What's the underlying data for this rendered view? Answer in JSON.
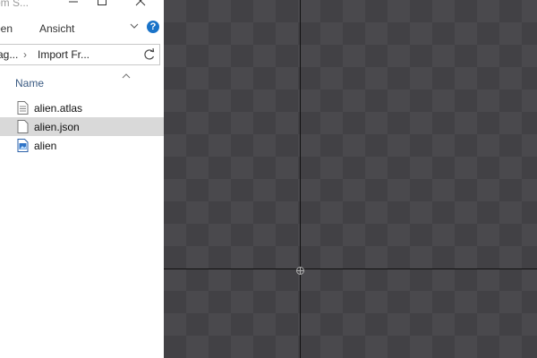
{
  "explorer": {
    "window_title": "om S...",
    "ribbon": {
      "tab_open": "ben",
      "tab_view": "Ansicht"
    },
    "address": {
      "crumb_parent": "ag...",
      "separator": "›",
      "crumb_current": "Import Fr..."
    },
    "column_name": "Name",
    "files": [
      {
        "name": "alien.atlas",
        "icon": "text-file-icon",
        "selected": false
      },
      {
        "name": "alien.json",
        "icon": "blank-file-icon",
        "selected": true
      },
      {
        "name": "alien",
        "icon": "image-file-icon",
        "selected": false
      }
    ],
    "help_glyph": "?"
  },
  "colors": {
    "canvas_light": "#4a494d",
    "canvas_dark": "#424145",
    "selection": "#d9d9d9",
    "help_blue": "#1a73c8"
  }
}
